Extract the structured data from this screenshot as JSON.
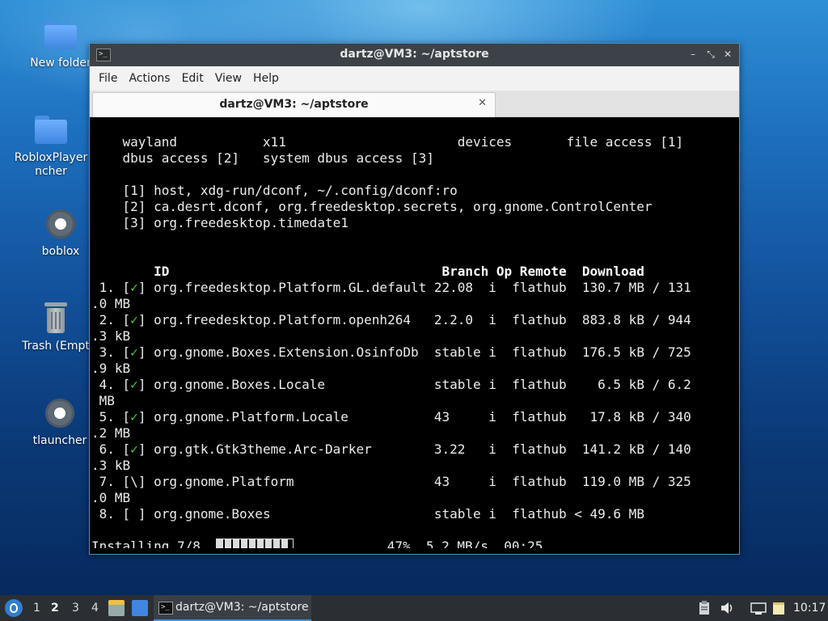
{
  "desktop": {
    "icons": [
      {
        "label": "New folder"
      },
      {
        "label": "RobloxPlayer\nncher"
      },
      {
        "label": "boblox"
      },
      {
        "label": "Trash (Empt"
      },
      {
        "label": "tlauncher"
      }
    ]
  },
  "window": {
    "title": "dartz@VM3: ~/aptstore",
    "title_icon": ">_",
    "controls": {
      "minimize": "–",
      "maximize": "⤡",
      "close": "✕"
    },
    "menu": [
      "File",
      "Actions",
      "Edit",
      "View",
      "Help"
    ],
    "tab": {
      "label": "dartz@VM3: ~/aptstore",
      "close": "✕"
    }
  },
  "terminal": {
    "permissions": [
      "    wayland           x11                      devices       file access [1]",
      "    dbus access [2]   system dbus access [3]"
    ],
    "notes": [
      "    [1] host, xdg-run/dconf, ~/.config/dconf:ro",
      "    [2] ca.desrt.dconf, org.freedesktop.secrets, org.gnome.ControlCenter",
      "    [3] org.freedesktop.timedate1"
    ],
    "header": "        ID                                   Branch Op Remote  Download",
    "rows": [
      {
        "pre": " 1. [",
        "mark": "✓",
        "post": "] org.freedesktop.Platform.GL.default 22.08  i  flathub  130.7 MB / 131",
        "wrap": ".0 MB"
      },
      {
        "pre": " 2. [",
        "mark": "✓",
        "post": "] org.freedesktop.Platform.openh264   2.2.0  i  flathub  883.8 kB / 944",
        "wrap": ".3 kB"
      },
      {
        "pre": " 3. [",
        "mark": "✓",
        "post": "] org.gnome.Boxes.Extension.OsinfoDb  stable i  flathub  176.5 kB / 725",
        "wrap": ".9 kB"
      },
      {
        "pre": " 4. [",
        "mark": "✓",
        "post": "] org.gnome.Boxes.Locale              stable i  flathub    6.5 kB / 6.2",
        "wrap": " MB"
      },
      {
        "pre": " 5. [",
        "mark": "✓",
        "post": "] org.gnome.Platform.Locale           43     i  flathub   17.8 kB / 340",
        "wrap": ".2 MB"
      },
      {
        "pre": " 6. [",
        "mark": "✓",
        "post": "] org.gtk.Gtk3theme.Arc-Darker        3.22   i  flathub  141.2 kB / 140",
        "wrap": ".3 kB"
      },
      {
        "pre": " 7. [",
        "mark": "\\",
        "post": "] org.gnome.Platform                  43     i  flathub  119.0 MB / 325",
        "wrap": ".0 MB"
      },
      {
        "pre": " 8. [",
        "mark": " ",
        "post": "] org.gnome.Boxes                     stable i  flathub < 49.6 MB",
        "wrap": ""
      }
    ],
    "status": {
      "label": "Installing 7/8… ",
      "progress_percent": 47,
      "tail": "            47%  5.2 MB/s  00:25"
    }
  },
  "taskbar": {
    "workspaces": [
      "1",
      "2",
      "3",
      "4"
    ],
    "active_workspace": "2",
    "task_label": "dartz@VM3: ~/aptstore",
    "clock": "10:17"
  },
  "colors": {
    "window_border": "#4a90c8",
    "titlebar": "#3c4248",
    "terminal_bg": "#000000",
    "checkmark": "#4ec94e",
    "taskbar": "#2b2f33",
    "task_underline": "#3f8fd6"
  }
}
